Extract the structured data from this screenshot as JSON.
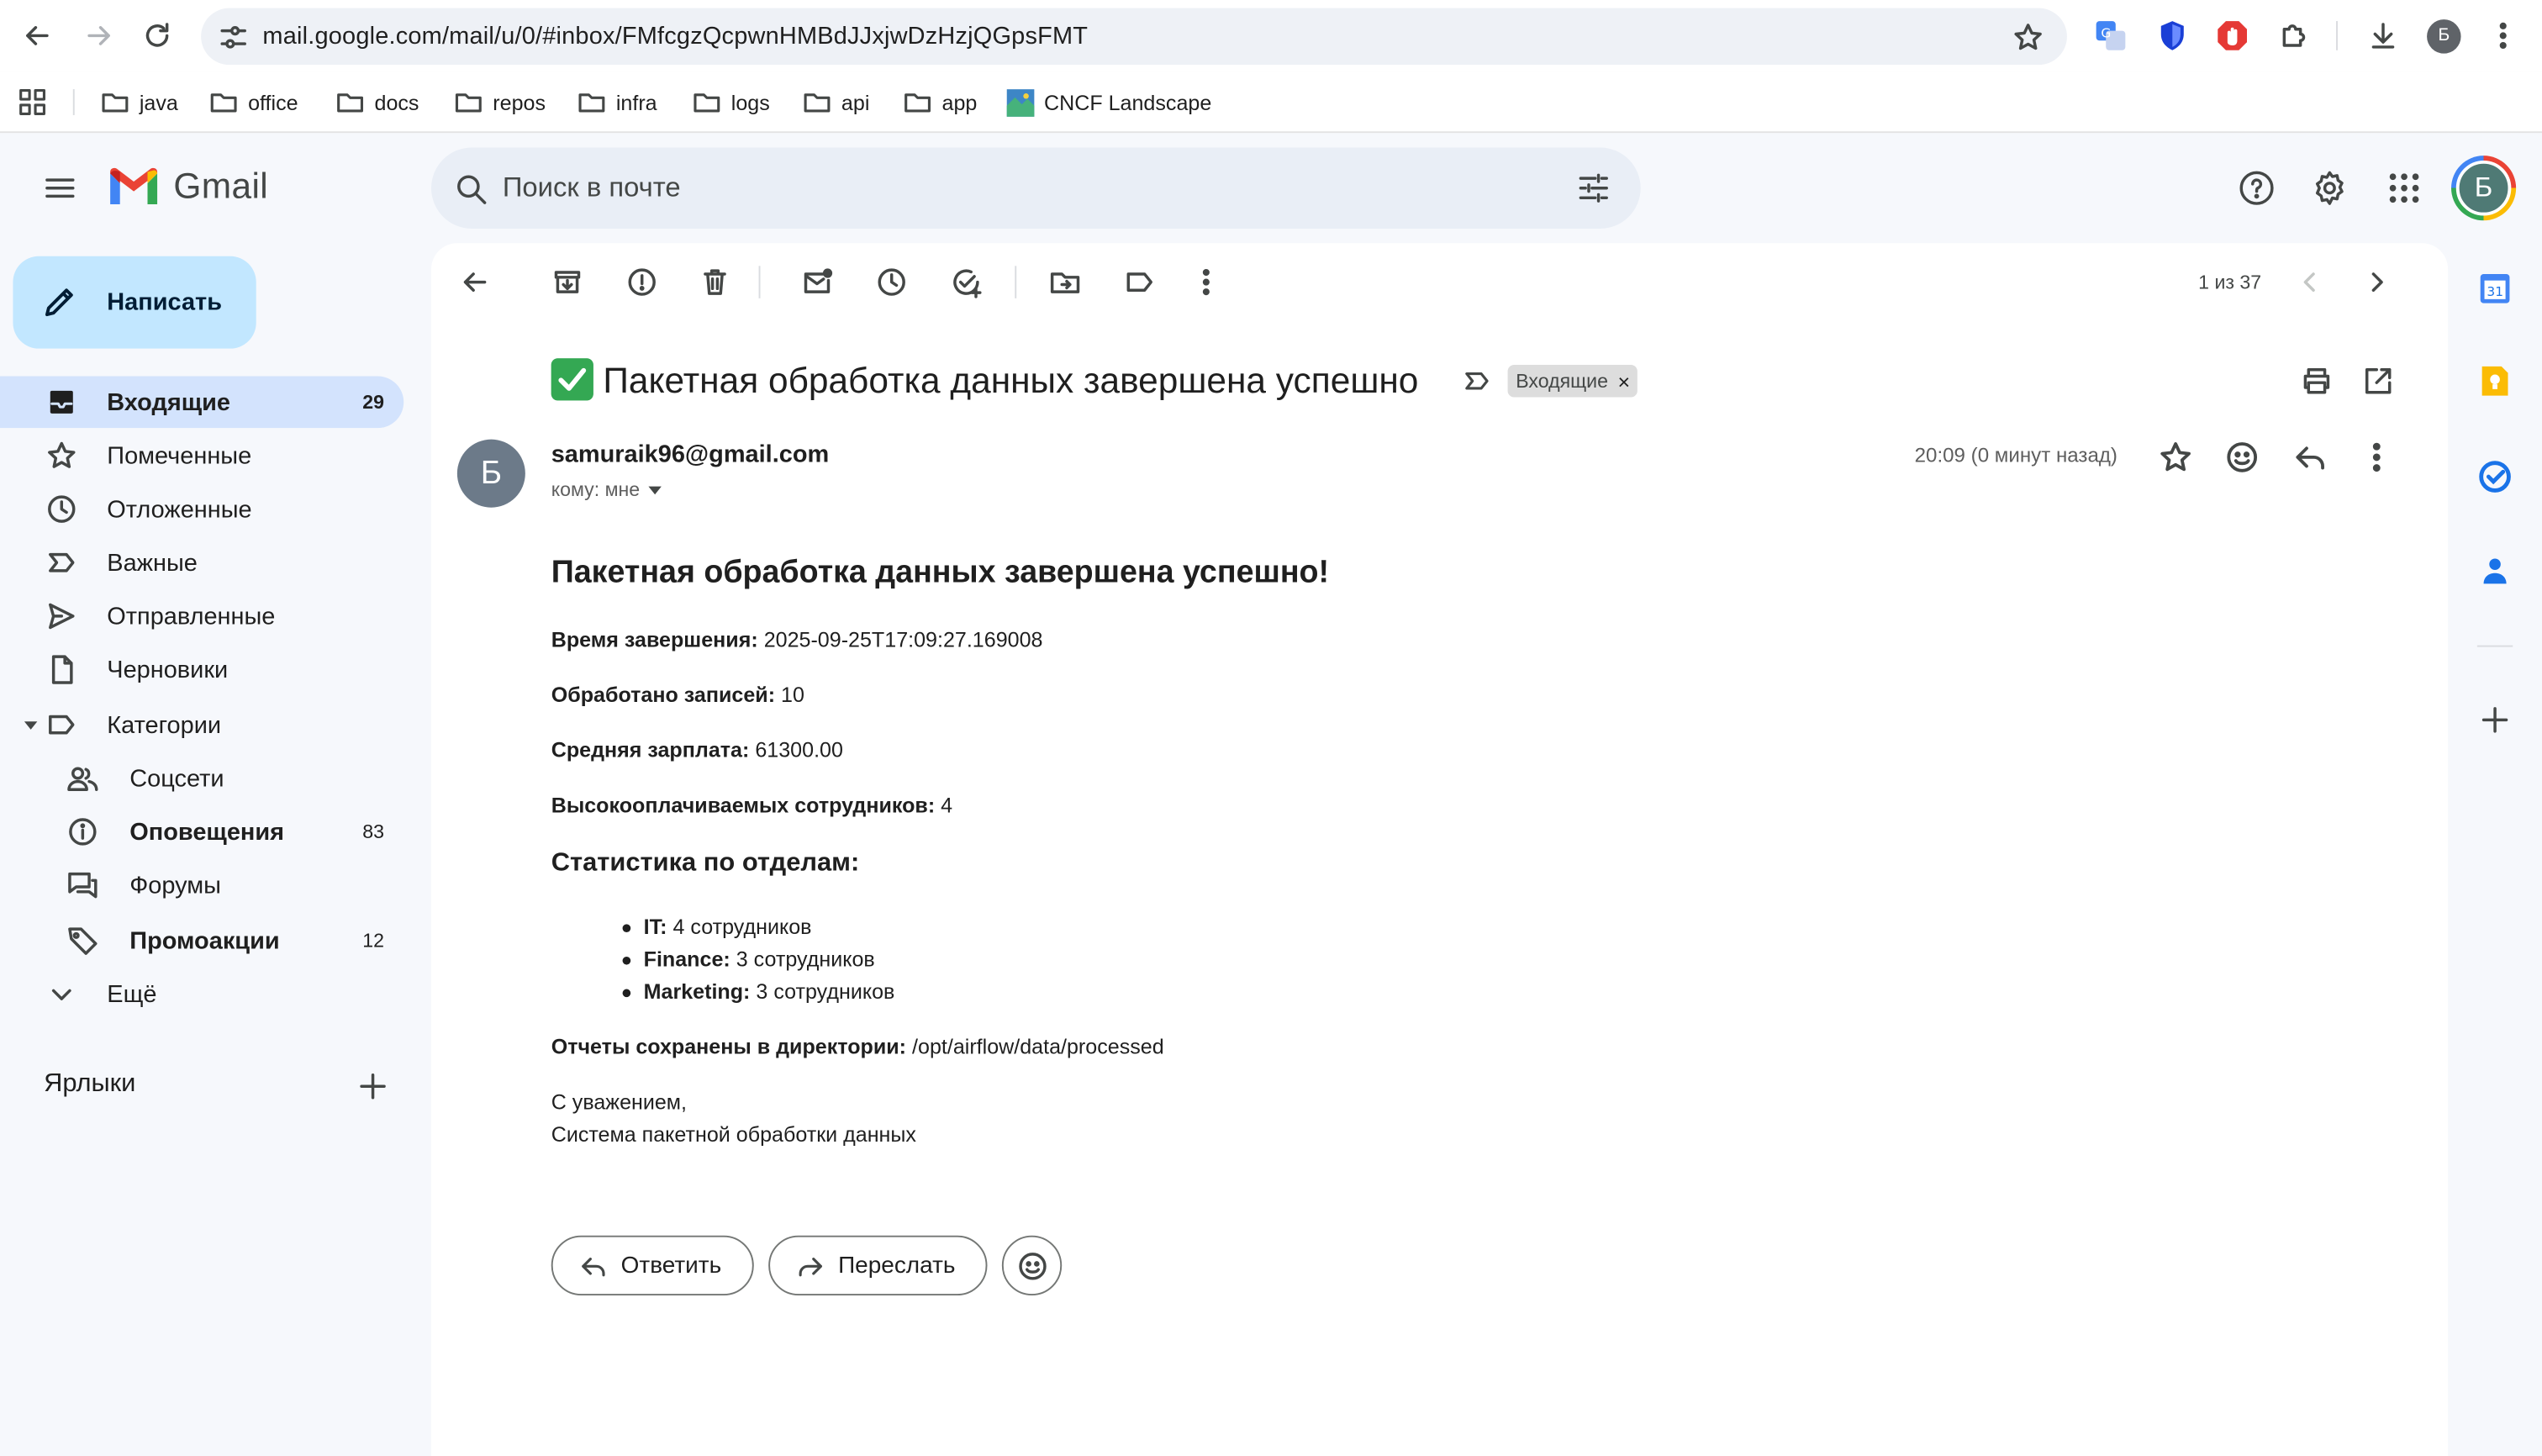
{
  "browser": {
    "url": "mail.google.com/mail/u/0/#inbox/FMfcgzQcpwnHMBdJJxjwDzHzjQGpsFMT",
    "profile_initial": "Б",
    "bookmarks": [
      "java",
      "office",
      "docs",
      "repos",
      "infra",
      "logs",
      "api",
      "app",
      "CNCF Landscape"
    ]
  },
  "gmail": {
    "logo_text": "Gmail",
    "search_placeholder": "Поиск в почте",
    "avatar_initial": "Б"
  },
  "sidebar": {
    "compose_label": "Написать",
    "items": [
      {
        "label": "Входящие",
        "count": "29"
      },
      {
        "label": "Помеченные",
        "count": ""
      },
      {
        "label": "Отложенные",
        "count": ""
      },
      {
        "label": "Важные",
        "count": ""
      },
      {
        "label": "Отправленные",
        "count": ""
      },
      {
        "label": "Черновики",
        "count": ""
      },
      {
        "label": "Категории",
        "count": ""
      },
      {
        "label": "Соцсети",
        "count": ""
      },
      {
        "label": "Оповещения",
        "count": "83"
      },
      {
        "label": "Форумы",
        "count": ""
      },
      {
        "label": "Промоакции",
        "count": "12"
      },
      {
        "label": "Ещё",
        "count": ""
      }
    ],
    "labels_title": "Ярлыки"
  },
  "toolbar": {
    "pager": "1 из 37"
  },
  "email": {
    "subject": "Пакетная обработка данных завершена успешно",
    "label_chip": "Входящие",
    "chip_close": "×",
    "sender_initial": "Б",
    "sender": "samuraik96@gmail.com",
    "to": "кому: мне",
    "time": "20:09 (0 минут назад)",
    "body": {
      "heading": "Пакетная обработка данных завершена успешно!",
      "completion_label": "Время завершения:",
      "completion_value": "2025-09-25T17:09:27.169008",
      "processed_label": "Обработано записей:",
      "processed_value": "10",
      "salary_label": "Средняя зарплата:",
      "salary_value": "61300.00",
      "highpaid_label": "Высокооплачиваемых сотрудников:",
      "highpaid_value": "4",
      "dept_heading": "Статистика по отделам:",
      "departments": [
        {
          "name": "IT:",
          "value": "4 сотрудников"
        },
        {
          "name": "Finance:",
          "value": "3 сотрудников"
        },
        {
          "name": "Marketing:",
          "value": "3 сотрудников"
        }
      ],
      "reports_label": "Отчеты сохранены в директории:",
      "reports_value": "/opt/airflow/data/processed",
      "signoff": "С уважением,",
      "signature": "Система пакетной обработки данных"
    },
    "reply_label": "Ответить",
    "forward_label": "Переслать"
  },
  "colors": {
    "accent": "#0b57d0",
    "compose_bg": "#c2e7ff",
    "active_nav": "#d3e3fd"
  }
}
